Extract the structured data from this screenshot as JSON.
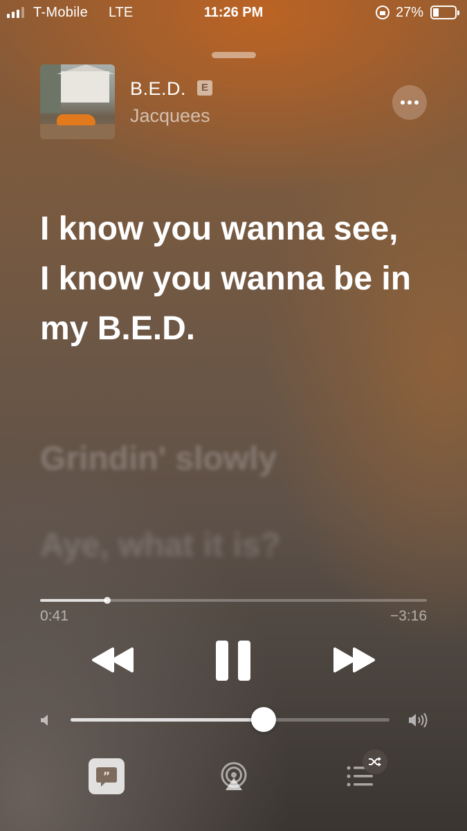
{
  "status_bar": {
    "carrier": "T-Mobile",
    "network": "LTE",
    "time": "11:26 PM",
    "battery_percent": "27%",
    "battery_level": 0.27,
    "icons": [
      "signal-icon",
      "orientation-lock-icon",
      "battery-icon"
    ]
  },
  "now_playing": {
    "title": "B.E.D.",
    "explicit_badge": "E",
    "artist": "Jacquees",
    "more_icon": "ellipsis-icon"
  },
  "lyrics": {
    "current": "I know you wanna see, I know you wanna be in my B.E.D.",
    "next": "Grindin' slowly",
    "next2": "Aye, what it is?"
  },
  "progress": {
    "elapsed": "0:41",
    "remaining": "−3:16",
    "fraction": 0.174
  },
  "controls": {
    "rewind_icon": "rewind-icon",
    "pause_icon": "pause-icon",
    "forward_icon": "fast-forward-icon"
  },
  "volume": {
    "level": 0.605,
    "low_icon": "speaker-low-icon",
    "high_icon": "speaker-high-icon"
  },
  "bottom_bar": {
    "lyrics_icon": "lyrics-quote-icon",
    "airplay_icon": "airplay-icon",
    "queue_icon": "queue-list-icon",
    "shuffle_icon": "shuffle-icon"
  },
  "colors": {
    "accent": "#ffffff",
    "background_top": "#8a5a35",
    "background_bottom": "#3a3531"
  }
}
